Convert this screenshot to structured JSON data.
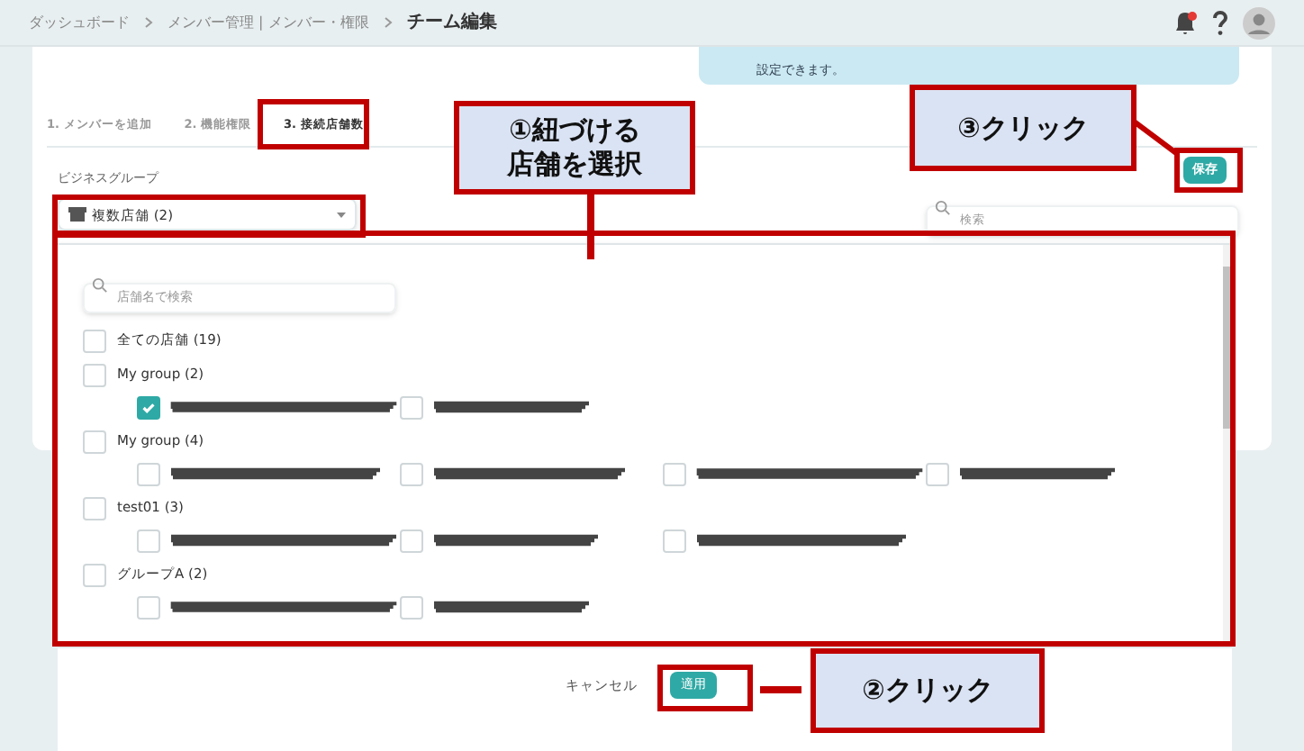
{
  "header": {
    "breadcrumbs": [
      "ダッシュボード",
      "メンバー管理 | メンバー・権限"
    ],
    "page_title": "チーム編集"
  },
  "info_banner": {
    "text": "設定できます。"
  },
  "tabs": [
    {
      "label": "1. メンバーを追加",
      "selected": false
    },
    {
      "label": "2. 機能権限",
      "selected": false
    },
    {
      "label": "3. 接続店舗数",
      "selected": true
    }
  ],
  "business_group": {
    "label": "ビジネスグループ",
    "value": "複数店舗 (2)"
  },
  "search": {
    "placeholder": "検索"
  },
  "save_button": "保存",
  "store_picker": {
    "search_placeholder": "店舗名で検索",
    "all_stores": {
      "label": "全ての店舗 (19)",
      "checked": false
    },
    "groups": [
      {
        "label": "My group (2)",
        "checked": false,
        "stores": [
          {
            "checked": true
          },
          {
            "checked": false
          }
        ]
      },
      {
        "label": "My group (4)",
        "checked": false,
        "stores": [
          {
            "checked": false
          },
          {
            "checked": false
          },
          {
            "checked": false
          },
          {
            "checked": false
          }
        ]
      },
      {
        "label": "test01 (3)",
        "checked": false,
        "stores": [
          {
            "checked": false
          },
          {
            "checked": false
          },
          {
            "checked": false
          }
        ]
      },
      {
        "label": "グループA (2)",
        "checked": false,
        "stores": [
          {
            "checked": false
          },
          {
            "checked": false
          }
        ]
      }
    ],
    "cancel": "キャンセル",
    "apply": "適用"
  },
  "callouts": [
    {
      "lines": [
        "①紐づける",
        "店舗を選択"
      ]
    },
    {
      "lines": [
        "③クリック"
      ]
    },
    {
      "lines": [
        "②クリック"
      ]
    }
  ]
}
